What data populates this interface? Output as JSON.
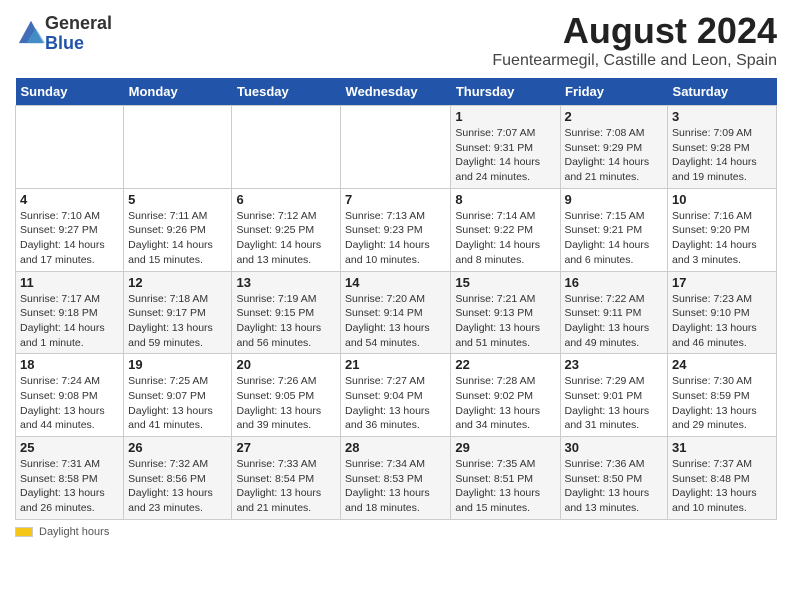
{
  "logo": {
    "general": "General",
    "blue": "Blue"
  },
  "title": "August 2024",
  "subtitle": "Fuentearmegil, Castille and Leon, Spain",
  "days_of_week": [
    "Sunday",
    "Monday",
    "Tuesday",
    "Wednesday",
    "Thursday",
    "Friday",
    "Saturday"
  ],
  "footer": {
    "daylight_label": "Daylight hours"
  },
  "weeks": [
    [
      {
        "day": "",
        "info": ""
      },
      {
        "day": "",
        "info": ""
      },
      {
        "day": "",
        "info": ""
      },
      {
        "day": "",
        "info": ""
      },
      {
        "day": "1",
        "info": "Sunrise: 7:07 AM\nSunset: 9:31 PM\nDaylight: 14 hours and 24 minutes."
      },
      {
        "day": "2",
        "info": "Sunrise: 7:08 AM\nSunset: 9:29 PM\nDaylight: 14 hours and 21 minutes."
      },
      {
        "day": "3",
        "info": "Sunrise: 7:09 AM\nSunset: 9:28 PM\nDaylight: 14 hours and 19 minutes."
      }
    ],
    [
      {
        "day": "4",
        "info": "Sunrise: 7:10 AM\nSunset: 9:27 PM\nDaylight: 14 hours and 17 minutes."
      },
      {
        "day": "5",
        "info": "Sunrise: 7:11 AM\nSunset: 9:26 PM\nDaylight: 14 hours and 15 minutes."
      },
      {
        "day": "6",
        "info": "Sunrise: 7:12 AM\nSunset: 9:25 PM\nDaylight: 14 hours and 13 minutes."
      },
      {
        "day": "7",
        "info": "Sunrise: 7:13 AM\nSunset: 9:23 PM\nDaylight: 14 hours and 10 minutes."
      },
      {
        "day": "8",
        "info": "Sunrise: 7:14 AM\nSunset: 9:22 PM\nDaylight: 14 hours and 8 minutes."
      },
      {
        "day": "9",
        "info": "Sunrise: 7:15 AM\nSunset: 9:21 PM\nDaylight: 14 hours and 6 minutes."
      },
      {
        "day": "10",
        "info": "Sunrise: 7:16 AM\nSunset: 9:20 PM\nDaylight: 14 hours and 3 minutes."
      }
    ],
    [
      {
        "day": "11",
        "info": "Sunrise: 7:17 AM\nSunset: 9:18 PM\nDaylight: 14 hours and 1 minute."
      },
      {
        "day": "12",
        "info": "Sunrise: 7:18 AM\nSunset: 9:17 PM\nDaylight: 13 hours and 59 minutes."
      },
      {
        "day": "13",
        "info": "Sunrise: 7:19 AM\nSunset: 9:15 PM\nDaylight: 13 hours and 56 minutes."
      },
      {
        "day": "14",
        "info": "Sunrise: 7:20 AM\nSunset: 9:14 PM\nDaylight: 13 hours and 54 minutes."
      },
      {
        "day": "15",
        "info": "Sunrise: 7:21 AM\nSunset: 9:13 PM\nDaylight: 13 hours and 51 minutes."
      },
      {
        "day": "16",
        "info": "Sunrise: 7:22 AM\nSunset: 9:11 PM\nDaylight: 13 hours and 49 minutes."
      },
      {
        "day": "17",
        "info": "Sunrise: 7:23 AM\nSunset: 9:10 PM\nDaylight: 13 hours and 46 minutes."
      }
    ],
    [
      {
        "day": "18",
        "info": "Sunrise: 7:24 AM\nSunset: 9:08 PM\nDaylight: 13 hours and 44 minutes."
      },
      {
        "day": "19",
        "info": "Sunrise: 7:25 AM\nSunset: 9:07 PM\nDaylight: 13 hours and 41 minutes."
      },
      {
        "day": "20",
        "info": "Sunrise: 7:26 AM\nSunset: 9:05 PM\nDaylight: 13 hours and 39 minutes."
      },
      {
        "day": "21",
        "info": "Sunrise: 7:27 AM\nSunset: 9:04 PM\nDaylight: 13 hours and 36 minutes."
      },
      {
        "day": "22",
        "info": "Sunrise: 7:28 AM\nSunset: 9:02 PM\nDaylight: 13 hours and 34 minutes."
      },
      {
        "day": "23",
        "info": "Sunrise: 7:29 AM\nSunset: 9:01 PM\nDaylight: 13 hours and 31 minutes."
      },
      {
        "day": "24",
        "info": "Sunrise: 7:30 AM\nSunset: 8:59 PM\nDaylight: 13 hours and 29 minutes."
      }
    ],
    [
      {
        "day": "25",
        "info": "Sunrise: 7:31 AM\nSunset: 8:58 PM\nDaylight: 13 hours and 26 minutes."
      },
      {
        "day": "26",
        "info": "Sunrise: 7:32 AM\nSunset: 8:56 PM\nDaylight: 13 hours and 23 minutes."
      },
      {
        "day": "27",
        "info": "Sunrise: 7:33 AM\nSunset: 8:54 PM\nDaylight: 13 hours and 21 minutes."
      },
      {
        "day": "28",
        "info": "Sunrise: 7:34 AM\nSunset: 8:53 PM\nDaylight: 13 hours and 18 minutes."
      },
      {
        "day": "29",
        "info": "Sunrise: 7:35 AM\nSunset: 8:51 PM\nDaylight: 13 hours and 15 minutes."
      },
      {
        "day": "30",
        "info": "Sunrise: 7:36 AM\nSunset: 8:50 PM\nDaylight: 13 hours and 13 minutes."
      },
      {
        "day": "31",
        "info": "Sunrise: 7:37 AM\nSunset: 8:48 PM\nDaylight: 13 hours and 10 minutes."
      }
    ]
  ]
}
